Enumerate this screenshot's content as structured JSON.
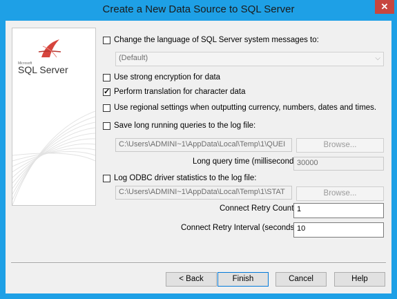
{
  "window": {
    "title": "Create a New Data Source to SQL Server",
    "close_glyph": "✕"
  },
  "logo": {
    "small": "Microsoft",
    "name": "SQL Server"
  },
  "options": {
    "change_language": {
      "label": "Change the language of SQL Server system messages to:",
      "checked": false
    },
    "language_select": {
      "value": "(Default)"
    },
    "strong_encryption": {
      "label": "Use strong encryption for data",
      "checked": false
    },
    "perform_translation": {
      "label": "Perform translation for character data",
      "checked": true
    },
    "regional_settings": {
      "label": "Use regional settings when outputting currency, numbers, dates and times.",
      "checked": false
    },
    "save_long_queries": {
      "label": "Save long running queries to the log file:",
      "checked": false
    },
    "long_query_file": {
      "value": "C:\\Users\\ADMINI~1\\AppData\\Local\\Temp\\1\\QUEI"
    },
    "browse_1": "Browse...",
    "long_query_time_label": "Long query time (milliseconds):",
    "long_query_time_value": "30000",
    "log_odbc_stats": {
      "label": "Log ODBC driver statistics to the log file:",
      "checked": false
    },
    "stats_file": {
      "value": "C:\\Users\\ADMINI~1\\AppData\\Local\\Temp\\1\\STAT"
    },
    "browse_2": "Browse...",
    "retry_count_label": "Connect Retry Count:",
    "retry_count_value": "1",
    "retry_interval_label": "Connect Retry Interval (seconds):",
    "retry_interval_value": "10"
  },
  "buttons": {
    "back": "< Back",
    "finish": "Finish",
    "cancel": "Cancel",
    "help": "Help"
  }
}
